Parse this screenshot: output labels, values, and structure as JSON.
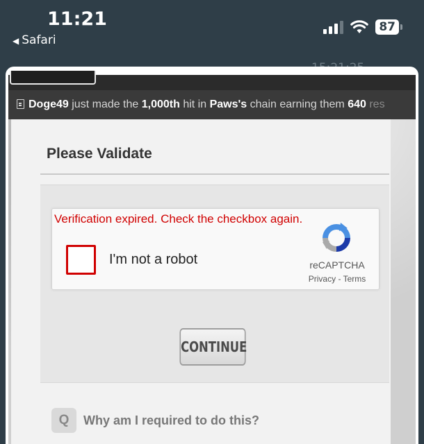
{
  "status_bar": {
    "time": "11:21",
    "back_app": "Safari",
    "battery": "87",
    "background_time": "15:21:25"
  },
  "ticker": {
    "user": "Doge49",
    "text_1": " just made the ",
    "hit": "1,000th",
    "text_2": " hit in ",
    "faction": "Paws's",
    "text_3": " chain earning them ",
    "points": "640",
    "text_4": " res"
  },
  "dialog": {
    "title": "Please Validate",
    "recaptcha": {
      "error": "Verification expired. Check the checkbox again.",
      "label": "I'm not a robot",
      "brand": "reCAPTCHA",
      "privacy": "Privacy",
      "separator": "-",
      "terms": "Terms"
    },
    "continue_label": "CONTINUE",
    "faq": {
      "icon_letter": "Q",
      "question": "Why am I required to do this?"
    }
  },
  "colors": {
    "status_bar_bg": "#2f3e48",
    "error_red": "#d00000",
    "ticker_bg": "#3a3a3a",
    "dialog_bg": "#f2f2f2"
  }
}
